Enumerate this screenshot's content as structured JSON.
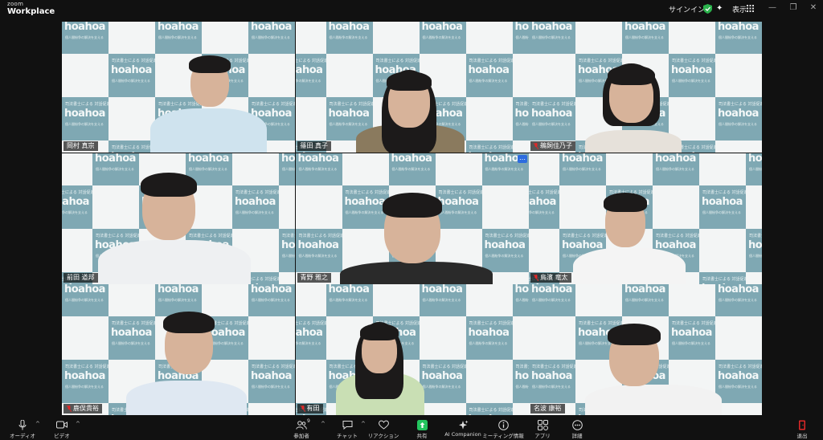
{
  "window": {
    "brand_top": "zoom",
    "brand_bottom": "Workplace",
    "signin": "サインイン",
    "view": "表示"
  },
  "participants": [
    {
      "name": "岡村 真宗",
      "muted": false,
      "shirt": "#cfe3ee"
    },
    {
      "name": "篠田 真子",
      "muted": false,
      "shirt": "#8a7a5e"
    },
    {
      "name": "鵜飼佳乃子",
      "muted": true,
      "shirt": "#e6e1da"
    },
    {
      "name": "前田 道邦",
      "muted": false,
      "shirt": "#eef0f2"
    },
    {
      "name": "青野 雅之",
      "muted": false,
      "shirt": "#2a2a2a"
    },
    {
      "name": "鳥濱 竜太",
      "muted": true,
      "shirt": "#f4f4f4"
    },
    {
      "name": "鹿俣貴裕",
      "muted": true,
      "shirt": "#dfe8f2"
    },
    {
      "name": "有田",
      "muted": true,
      "shirt": "#c9dfb4"
    },
    {
      "name": "名波 康裕",
      "muted": false,
      "shirt": "#f2f2f2"
    }
  ],
  "background": {
    "line1": "司法書士による",
    "line2": "対話促進ネットワーク",
    "brand": "hoahoa",
    "line3": "個人間紛争の解決を支える",
    "accent": "#7fa8b3"
  },
  "toolbar": {
    "audio": "オーディオ",
    "video": "ビデオ",
    "participants": "参加者",
    "participants_count": "9",
    "chat": "チャット",
    "reactions": "リアクション",
    "share": "共有",
    "ai": "AI Companion",
    "meeting_info": "ミーティング情報",
    "apps": "アプリ",
    "more": "詳細",
    "leave": "退出"
  },
  "colors": {
    "active_speaker": "#23d959",
    "share_green": "#23c55e",
    "leave_red": "#e02828",
    "shield_green": "#2bb24c"
  }
}
